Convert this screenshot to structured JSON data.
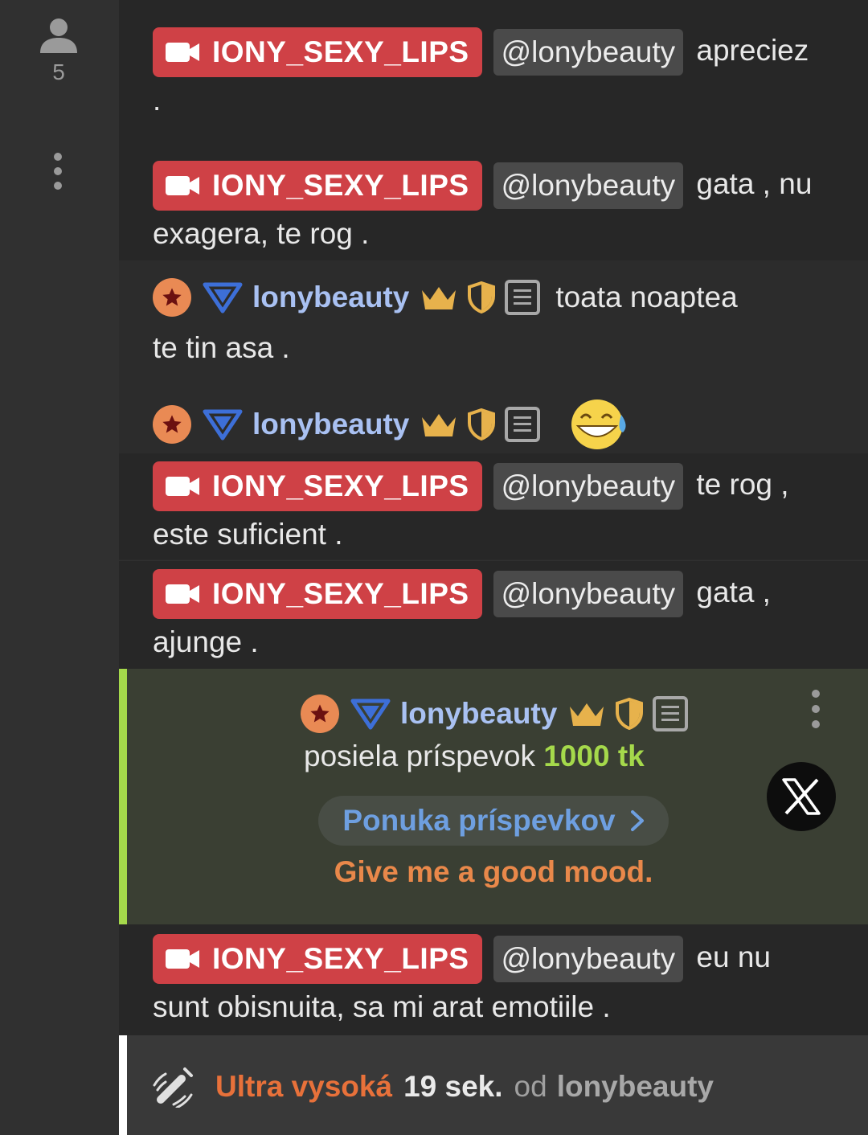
{
  "sidebar": {
    "viewer_icon": "person-icon",
    "viewer_count": "5",
    "menu_icon": "kebab-menu-icon"
  },
  "messages": [
    {
      "sender": "IONY_SEXY_LIPS",
      "mention": "@lonybeauty",
      "text_1": "apreciez",
      "text_2": "."
    },
    {
      "sender": "IONY_SEXY_LIPS",
      "mention": "@lonybeauty",
      "text_1": "gata , nu",
      "text_2": "exagera, te rog ."
    },
    {
      "user": "lonybeauty",
      "text_1": "toata noaptea",
      "text_2": "te tin asa ."
    },
    {
      "user": "lonybeauty",
      "emoji": "😅"
    },
    {
      "sender": "IONY_SEXY_LIPS",
      "mention": "@lonybeauty",
      "text_1": "te rog ,",
      "text_2": "este suficient ."
    },
    {
      "sender": "IONY_SEXY_LIPS",
      "mention": "@lonybeauty",
      "text_1": "gata ,",
      "text_2": "ajunge ."
    },
    {
      "sender": "IONY_SEXY_LIPS",
      "mention": "@lonybeauty",
      "text_1": "eu nu",
      "text_2": "sunt obisnuita, sa mi arat emotiile ."
    }
  ],
  "tip": {
    "user": "lonybeauty",
    "action": "posiela príspevok",
    "amount": "1000 tk",
    "menu_button": "Ponuka príspevkov",
    "note": "Give me a good mood.",
    "x_icon": "x-logo-icon"
  },
  "footer": {
    "level": "Ultra vysoká",
    "time": "19 sek.",
    "from": "od",
    "user": "lonybeauty"
  },
  "colors": {
    "badge_red": "#cf4146",
    "username_blue": "#a9c1f2",
    "tip_green": "#a5d94b",
    "note_orange": "#e9884a",
    "level_orange": "#e8713a",
    "button_blue": "#6e9fe0"
  }
}
